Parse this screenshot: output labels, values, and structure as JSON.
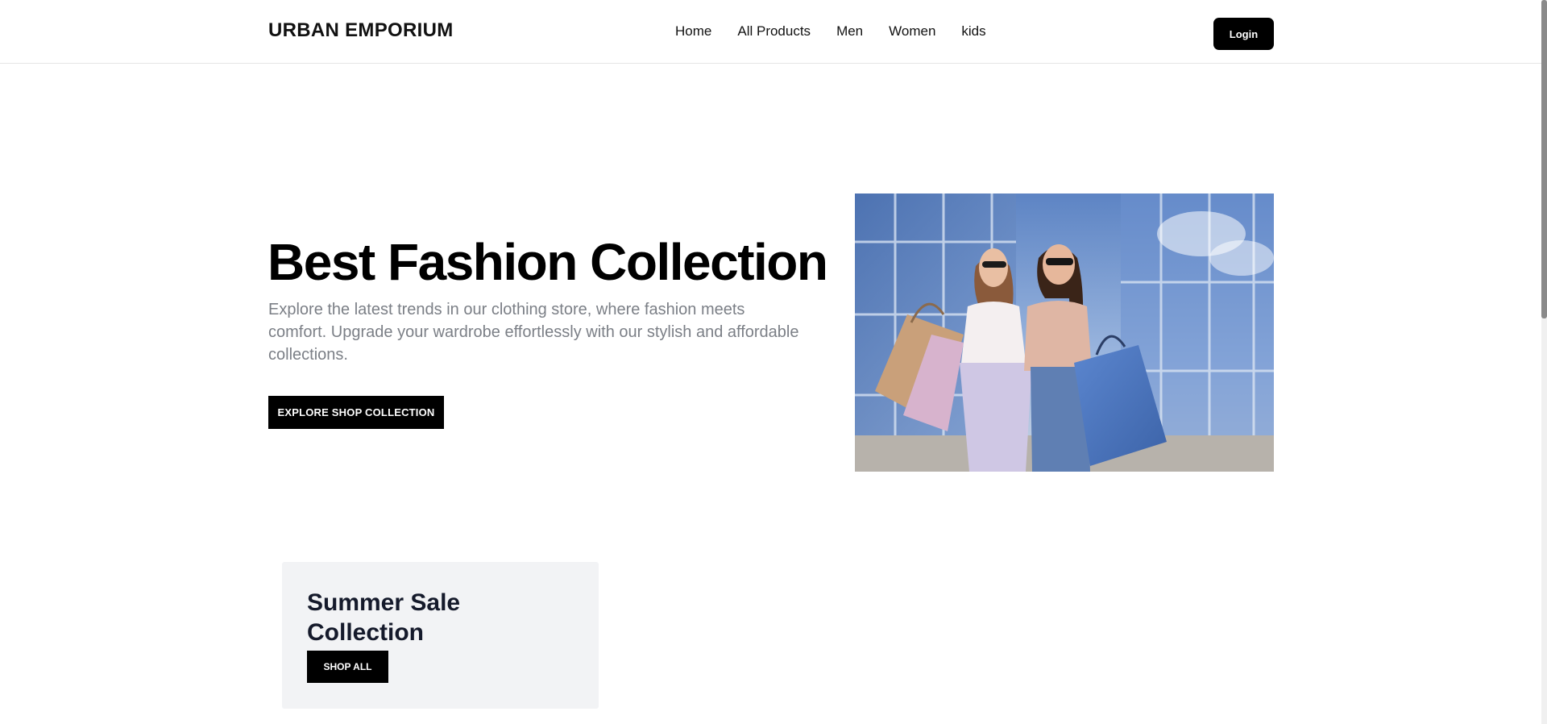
{
  "header": {
    "logo": "URBAN EMPORIUM",
    "nav": [
      "Home",
      "All Products",
      "Men",
      "Women",
      "kids"
    ],
    "login_label": "Login"
  },
  "hero": {
    "title": "Best Fashion Collection",
    "description": "Explore the latest trends in our clothing store, where fashion meets comfort. Upgrade your wardrobe effortlessly with our stylish and affordable collections.",
    "cta_label": "EXPLORE SHOP COLLECTION"
  },
  "promo": {
    "title": "Summer Sale Collection",
    "cta_label": "SHOP ALL"
  }
}
